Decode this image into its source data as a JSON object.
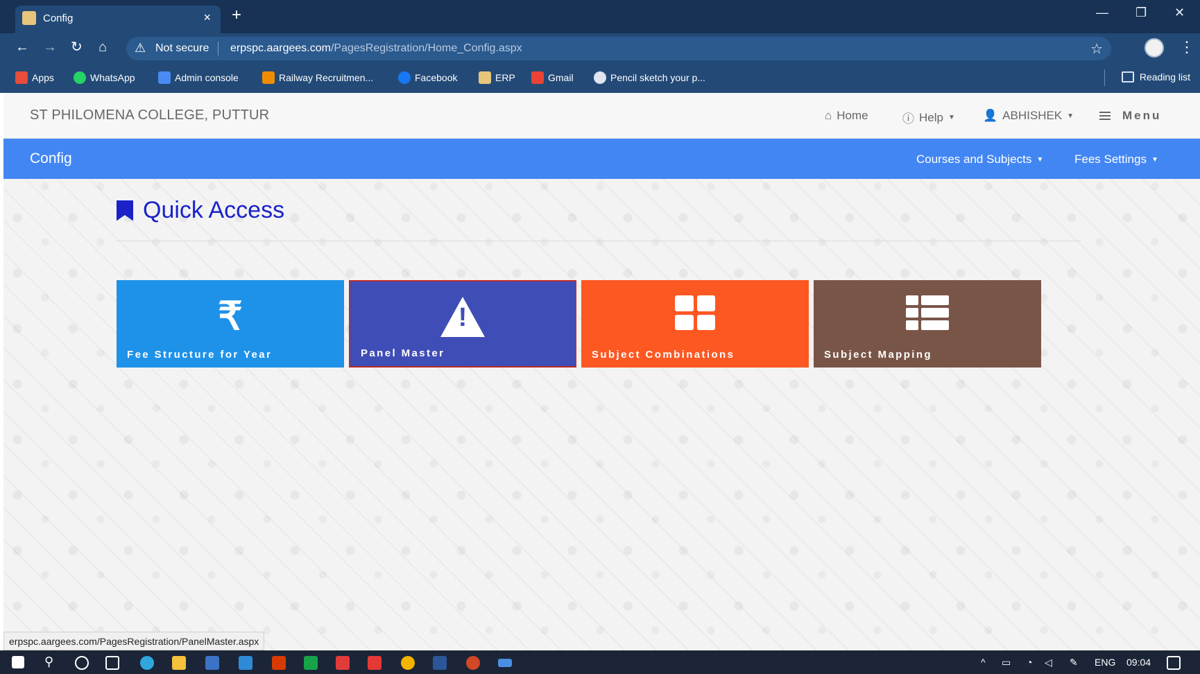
{
  "browser": {
    "tab_title": "Config",
    "tab_close": "×",
    "new_tab": "+",
    "security": "Not secure",
    "url_host": "erpspc.aargees.com",
    "url_path": "/PagesRegistration/Home_Config.aspx",
    "bookmarks": [
      "Apps",
      "WhatsApp",
      "Admin console",
      "Railway Recruitmen...",
      "Facebook",
      "ERP",
      "Gmail",
      "Pencil sketch your p..."
    ],
    "reading_list": "Reading list"
  },
  "header": {
    "brand": "ST PHILOMENA COLLEGE, PUTTUR",
    "home": "Home",
    "help": "Help",
    "user": "ABHISHEK",
    "menu": "Menu"
  },
  "subheader": {
    "title": "Config",
    "courses": "Courses and Subjects",
    "fees": "Fees Settings"
  },
  "main": {
    "heading": "Quick Access",
    "tiles": [
      {
        "label": "Fee Structure for Year",
        "icon": "rupee-icon",
        "color": "#1e92e8"
      },
      {
        "label": "Panel Master",
        "icon": "warning-icon",
        "color": "#3f4db6"
      },
      {
        "label": "Subject Combinations",
        "icon": "grid-icon",
        "color": "#fd5722"
      },
      {
        "label": "Subject Mapping",
        "icon": "list-icon",
        "color": "#795548"
      }
    ]
  },
  "status_bar": {
    "hover_url": "erpspc.aargees.com/PagesRegistration/PanelMaster.aspx"
  },
  "taskbar": {
    "language": "ENG",
    "time": "09:04"
  }
}
